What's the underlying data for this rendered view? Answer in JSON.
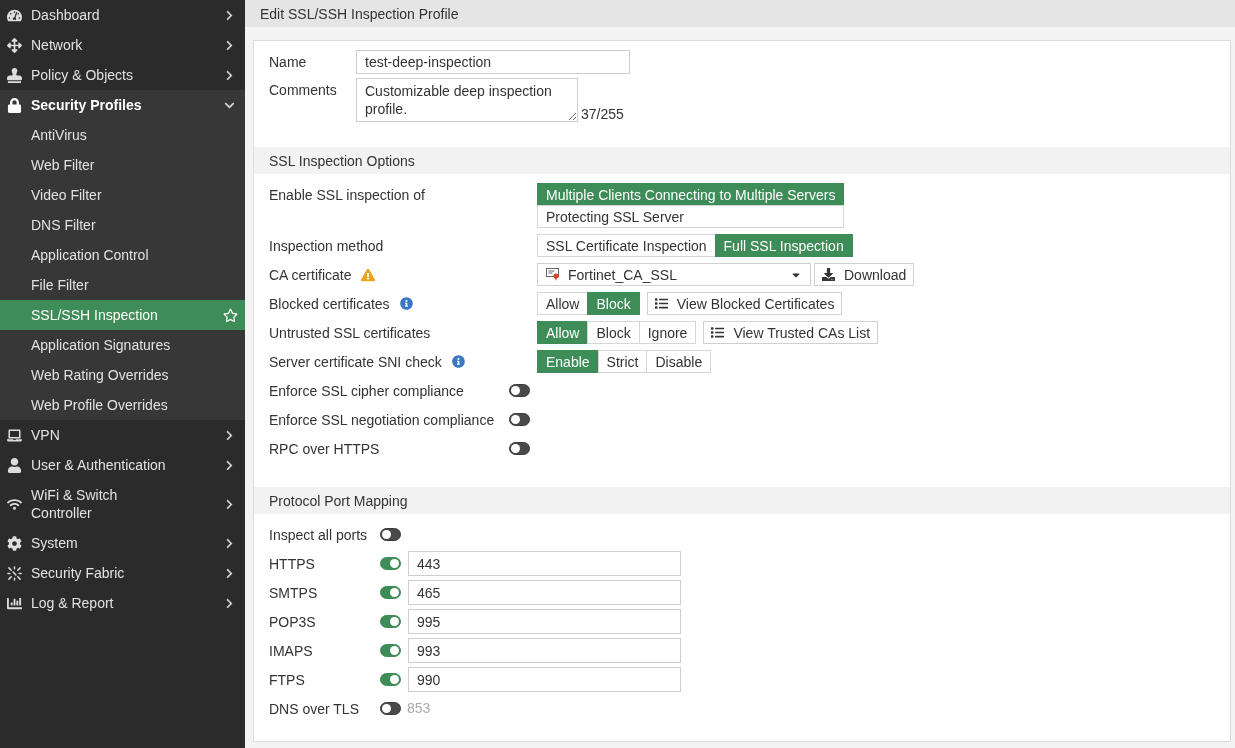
{
  "header": {
    "title": "Edit SSL/SSH Inspection Profile"
  },
  "sidebar": {
    "items": [
      {
        "label": "Dashboard",
        "selected": false,
        "expanded": false
      },
      {
        "label": "Network",
        "selected": false,
        "expanded": false
      },
      {
        "label": "Policy & Objects",
        "selected": false,
        "expanded": false
      },
      {
        "label": "Security Profiles",
        "selected": false,
        "expanded": true,
        "children": [
          {
            "label": "AntiVirus",
            "selected": false
          },
          {
            "label": "Web Filter",
            "selected": false
          },
          {
            "label": "Video Filter",
            "selected": false
          },
          {
            "label": "DNS Filter",
            "selected": false
          },
          {
            "label": "Application Control",
            "selected": false
          },
          {
            "label": "File Filter",
            "selected": false
          },
          {
            "label": "SSL/SSH Inspection",
            "selected": true
          },
          {
            "label": "Application Signatures",
            "selected": false
          },
          {
            "label": "Web Rating Overrides",
            "selected": false
          },
          {
            "label": "Web Profile Overrides",
            "selected": false
          }
        ]
      },
      {
        "label": "VPN",
        "selected": false,
        "expanded": false
      },
      {
        "label": "User & Authentication",
        "selected": false,
        "expanded": false
      },
      {
        "label": "WiFi & Switch Controller",
        "selected": false,
        "expanded": false
      },
      {
        "label": "System",
        "selected": false,
        "expanded": false
      },
      {
        "label": "Security Fabric",
        "selected": false,
        "expanded": false
      },
      {
        "label": "Log & Report",
        "selected": false,
        "expanded": false
      }
    ]
  },
  "form": {
    "name": {
      "label": "Name",
      "value": "test-deep-inspection"
    },
    "comments": {
      "label": "Comments",
      "value": "Customizable deep inspection profile.",
      "counter": "37/255"
    }
  },
  "sections": [
    {
      "title": "SSL Inspection Options",
      "rows": [
        {
          "kind": "stacked",
          "label": "Enable SSL inspection of",
          "options": [
            {
              "label": "Multiple Clients Connecting to Multiple Servers",
              "selected": true
            },
            {
              "label": "Protecting SSL Server",
              "selected": false
            }
          ]
        },
        {
          "kind": "segmented",
          "label": "Inspection method",
          "options": [
            {
              "label": "SSL Certificate Inspection",
              "selected": false
            },
            {
              "label": "Full SSL Inspection",
              "selected": true
            }
          ]
        },
        {
          "kind": "select",
          "label": "CA certificate",
          "badge": {
            "kind": "warning"
          },
          "value": "Fortinet_CA_SSL",
          "button": "Download"
        },
        {
          "kind": "segmented",
          "label": "Blocked certificates",
          "badge": {
            "kind": "info"
          },
          "options": [
            {
              "label": "Allow",
              "selected": false
            },
            {
              "label": "Block",
              "selected": true
            }
          ],
          "button": "View Blocked Certificates"
        },
        {
          "kind": "segmented",
          "label": "Untrusted SSL certificates",
          "options": [
            {
              "label": "Allow",
              "selected": true
            },
            {
              "label": "Block",
              "selected": false
            },
            {
              "label": "Ignore",
              "selected": false
            }
          ],
          "button": "View Trusted CAs List"
        },
        {
          "kind": "segmented",
          "label": "Server certificate SNI check",
          "badge": {
            "kind": "info"
          },
          "options": [
            {
              "label": "Enable",
              "selected": true
            },
            {
              "label": "Strict",
              "selected": false
            },
            {
              "label": "Disable",
              "selected": false
            }
          ]
        },
        {
          "kind": "toggle",
          "label": "Enforce SSL cipher compliance",
          "on": false
        },
        {
          "kind": "toggle",
          "label": "Enforce SSL negotiation compliance",
          "on": false
        },
        {
          "kind": "toggle",
          "label": "RPC over HTTPS",
          "on": false
        }
      ]
    },
    {
      "title": "Protocol Port Mapping",
      "rows": [
        {
          "kind": "toggle",
          "label": "Inspect all ports",
          "on": false
        },
        {
          "kind": "port",
          "label": "HTTPS",
          "on": true,
          "value": "443"
        },
        {
          "kind": "port",
          "label": "SMTPS",
          "on": true,
          "value": "465"
        },
        {
          "kind": "port",
          "label": "POP3S",
          "on": true,
          "value": "995"
        },
        {
          "kind": "port",
          "label": "IMAPS",
          "on": true,
          "value": "993"
        },
        {
          "kind": "port",
          "label": "FTPS",
          "on": true,
          "value": "990"
        },
        {
          "kind": "port",
          "label": "DNS over TLS",
          "on": false,
          "value": "853"
        }
      ]
    }
  ]
}
